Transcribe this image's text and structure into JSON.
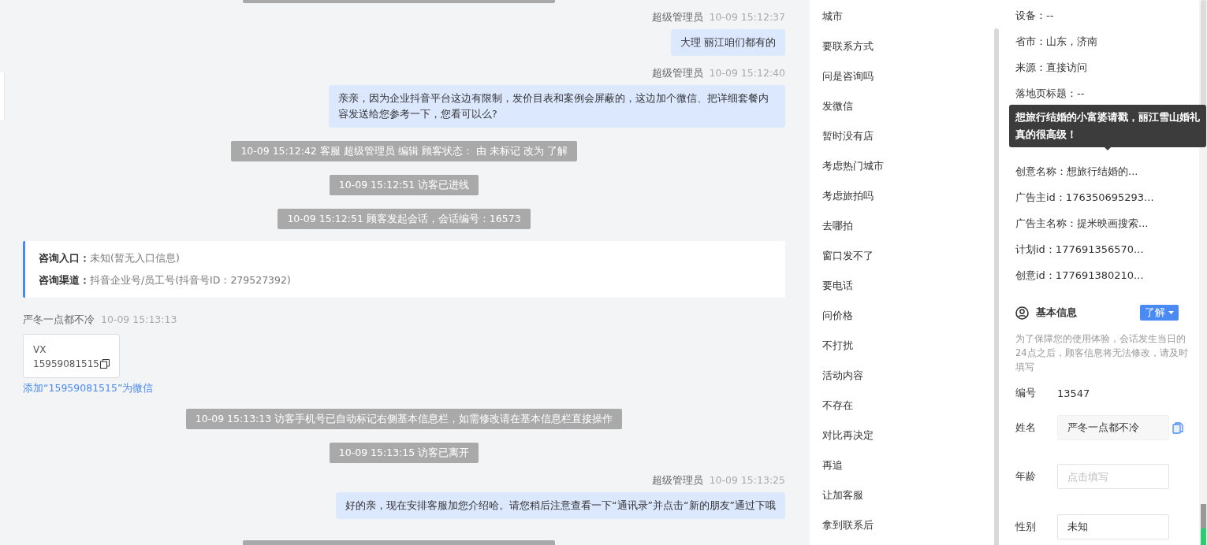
{
  "chat": {
    "messages": [
      {
        "kind": "agent",
        "sender": "超级管理员",
        "time": "10-09 15:12:37",
        "text": "大理 丽江咱们都有的"
      },
      {
        "kind": "agent",
        "sender": "超级管理员",
        "time": "10-09 15:12:40",
        "text": "亲亲，因为企业抖音平台这边有限制，发价目表和案例会屏蔽的，这边加个微信、把详细套餐内容发送给您参考一下，您看可以么?"
      },
      {
        "kind": "system",
        "text": "10-09 15:12:42 客服 超级管理员 编辑 顾客状态： 由 未标记 改为 了解"
      },
      {
        "kind": "system",
        "text": "10-09 15:12:51 访客已进线"
      },
      {
        "kind": "system",
        "text": "10-09 15:12:51 顾客发起会话，会话编号：16573"
      },
      {
        "kind": "info",
        "rows": [
          {
            "label": "咨询入口：",
            "value": "未知(暂无入口信息)"
          },
          {
            "label": "咨询渠道：",
            "value": "抖音企业号/员工号(抖音号ID：279527392)"
          }
        ]
      },
      {
        "kind": "visitor",
        "sender": "严冬一点都不冷",
        "time": "10-09 15:13:13",
        "card_title": "VX",
        "card_number": "15959081515",
        "link": "添加“15959081515”为微信"
      },
      {
        "kind": "system",
        "text": "10-09 15:13:13 访客手机号已自动标记右侧基本信息栏，如需修改请在基本信息栏直接操作"
      },
      {
        "kind": "system",
        "text": "10-09 15:13:15 访客已离开"
      },
      {
        "kind": "agent",
        "sender": "超级管理员",
        "time": "10-09 15:13:25",
        "text": "好的亲，现在安排客服加您介绍哈。请您稍后注意查看一下“通讯录”并点击“新的朋友”通过下哦"
      }
    ]
  },
  "quick_replies": [
    "城市",
    "要联系方式",
    "问是咨询吗",
    "发微信",
    "暂时没有店",
    "考虑热门城市",
    "考虑旅拍吗",
    "去哪拍",
    "窗口发不了",
    "要电话",
    "问价格",
    "不打扰",
    "活动内容",
    "不存在",
    "对比再决定",
    "再追",
    "让加客服",
    "拿到联系后"
  ],
  "source_info": {
    "rows_before": [
      "设备：--",
      "省市：山东，济南",
      "来源：直接访问",
      "落地页标题：--"
    ],
    "tooltip": "想旅行结婚的小富婆请戳，丽江雪山婚礼真的很高级！",
    "rows_after": [
      "创意名称：想旅行结婚的...",
      "广告主id：176350695293...",
      "广告主名称：提米映画搜索...",
      "计划id：177691356570...",
      "创意id：177691380210..."
    ]
  },
  "basic_info": {
    "title": "基本信息",
    "status": "了解",
    "note": "为了保障您的使用体验，会话发生当日的24点之后，顾客信息将无法修改，请及时填写",
    "fields": [
      {
        "kind": "text",
        "label": "编号",
        "value": "13547"
      },
      {
        "kind": "copy",
        "label": "姓名",
        "value": "严冬一点都不冷"
      },
      {
        "kind": "input",
        "label": "年龄",
        "placeholder": "点击填写"
      },
      {
        "kind": "select",
        "label": "性别",
        "value": "未知"
      }
    ]
  }
}
